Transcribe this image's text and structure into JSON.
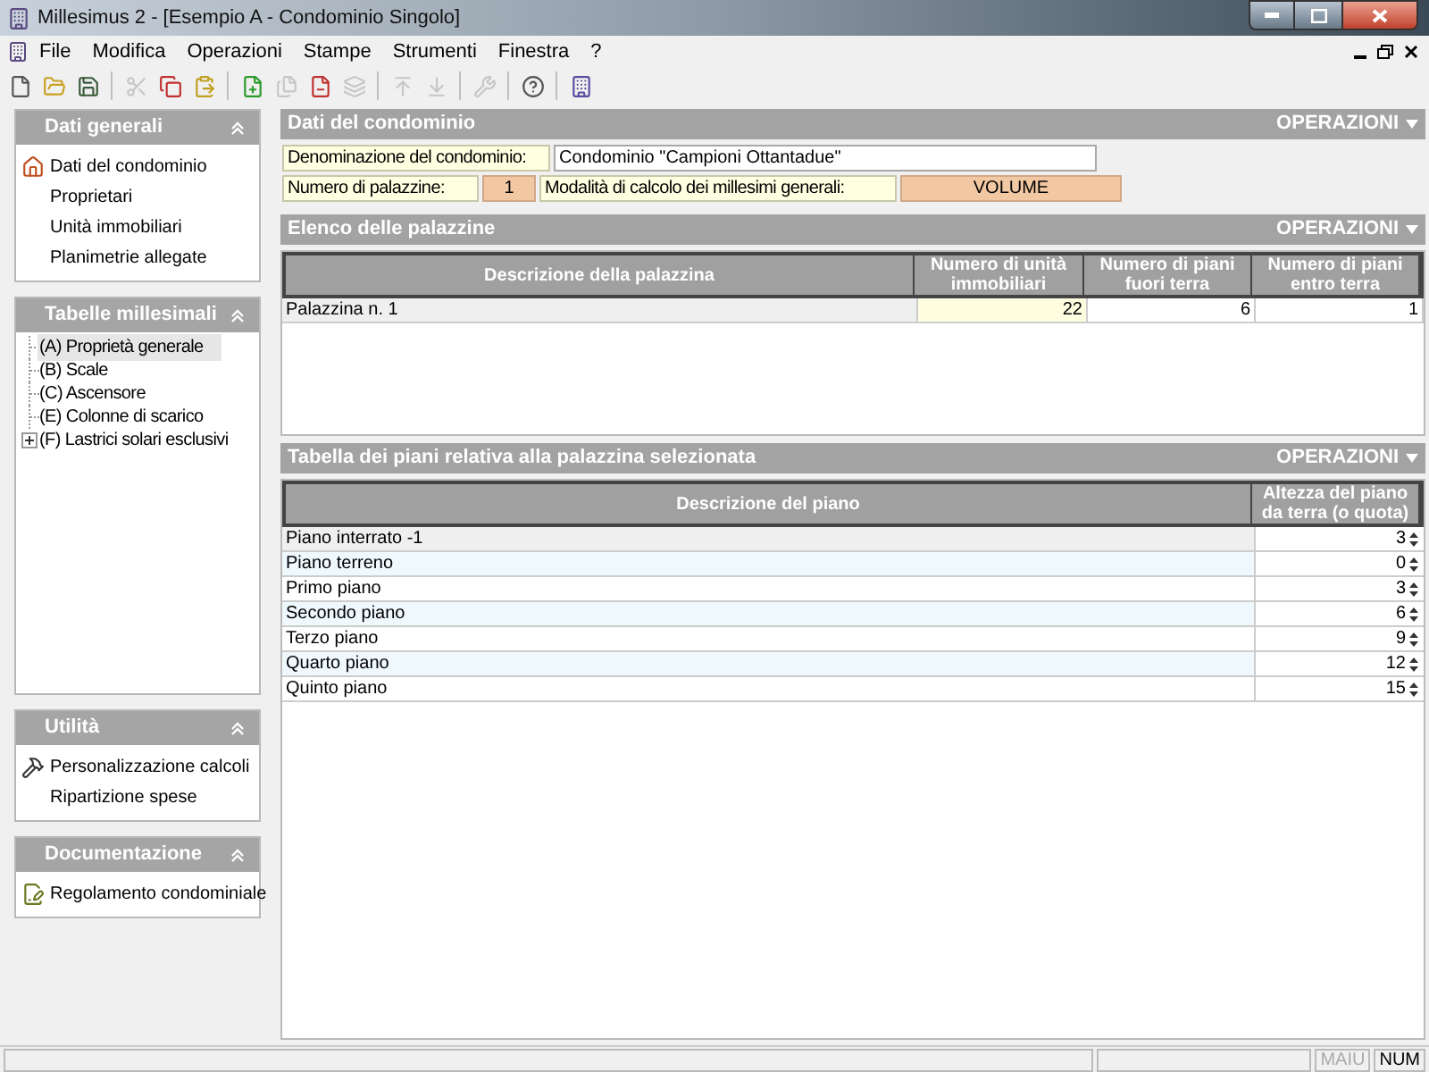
{
  "window": {
    "title": "Millesimus 2 - [Esempio A - Condominio Singolo]"
  },
  "menu": [
    "File",
    "Modifica",
    "Operazioni",
    "Stampe",
    "Strumenti",
    "Finestra",
    "?"
  ],
  "toolbar": [
    {
      "kind": "button",
      "disabled": false
    },
    {
      "kind": "button",
      "disabled": false
    },
    {
      "kind": "button",
      "disabled": false
    },
    {
      "kind": "separator"
    },
    {
      "kind": "button",
      "disabled": true
    },
    {
      "kind": "button",
      "disabled": false
    },
    {
      "kind": "button",
      "disabled": false
    },
    {
      "kind": "separator"
    },
    {
      "kind": "button",
      "disabled": false
    },
    {
      "kind": "button",
      "disabled": true
    },
    {
      "kind": "button",
      "disabled": false
    },
    {
      "kind": "button",
      "disabled": true
    },
    {
      "kind": "separator"
    },
    {
      "kind": "button",
      "disabled": true
    },
    {
      "kind": "button",
      "disabled": true
    },
    {
      "kind": "separator"
    },
    {
      "kind": "button",
      "disabled": true
    },
    {
      "kind": "separator"
    },
    {
      "kind": "button",
      "disabled": false
    },
    {
      "kind": "separator"
    },
    {
      "kind": "button",
      "disabled": false
    }
  ],
  "sidebar": [
    {
      "title": "Dati generali",
      "kind": "links",
      "items": [
        {
          "label": "Dati del condominio",
          "icon": true
        },
        {
          "label": "Proprietari",
          "icon": false
        },
        {
          "label": "Unità immobiliari",
          "icon": false
        },
        {
          "label": "Planimetrie allegate",
          "icon": false
        }
      ]
    },
    {
      "title": "Tabelle millesimali",
      "kind": "tree",
      "items": [
        {
          "label": "(A) Proprietà generale",
          "selected": true,
          "expander": false
        },
        {
          "label": "(B) Scale",
          "selected": false,
          "expander": false
        },
        {
          "label": "(C) Ascensore",
          "selected": false,
          "expander": false
        },
        {
          "label": "(E) Colonne di scarico",
          "selected": false,
          "expander": false
        },
        {
          "label": "(F) Lastrici solari esclusivi",
          "selected": false,
          "expander": true
        }
      ]
    },
    {
      "title": "Utilità",
      "kind": "links",
      "items": [
        {
          "label": "Personalizzazione calcoli",
          "icon": true
        },
        {
          "label": "Ripartizione spese",
          "icon": false
        }
      ]
    },
    {
      "title": "Documentazione",
      "kind": "links",
      "items": [
        {
          "label": "Regolamento condominiale",
          "icon": true
        }
      ]
    }
  ],
  "dati_condominio": {
    "title": "Dati del condominio",
    "operations": "OPERAZIONI",
    "name_label": "Denominazione del condominio:",
    "name_value": "Condominio \"Campioni Ottantadue\"",
    "count_label": "Numero di palazzine:",
    "count_value": "1",
    "mode_label": "Modalità di calcolo dei millesimi generali:",
    "mode_value": "VOLUME"
  },
  "palazzine": {
    "title": "Elenco delle palazzine",
    "operations": "OPERAZIONI",
    "columns": [
      "Descrizione della palazzina",
      "Numero di unità immobiliari",
      "Numero di piani fuori terra",
      "Numero di piani entro terra"
    ],
    "rows": [
      {
        "cells": [
          "Palazzina n. 1",
          "22",
          "6",
          "1"
        ],
        "selected": true
      }
    ]
  },
  "piani": {
    "title": "Tabella dei piani relativa alla palazzina selezionata",
    "operations": "OPERAZIONI",
    "columns": [
      "Descrizione del piano",
      "Altezza del piano da terra (o quota)"
    ],
    "rows": [
      {
        "cells": [
          "Piano interrato -1",
          "3"
        ],
        "selected": true
      },
      {
        "cells": [
          "Piano terreno",
          "0"
        ],
        "selected": false
      },
      {
        "cells": [
          "Primo piano",
          "3"
        ],
        "selected": false
      },
      {
        "cells": [
          "Secondo piano",
          "6"
        ],
        "selected": false
      },
      {
        "cells": [
          "Terzo piano",
          "9"
        ],
        "selected": false
      },
      {
        "cells": [
          "Quarto piano",
          "12"
        ],
        "selected": false
      },
      {
        "cells": [
          "Quinto piano",
          "15"
        ],
        "selected": false
      }
    ]
  },
  "status_bar": [
    {
      "text": "MAIU",
      "on": false
    },
    {
      "text": "NUM",
      "on": true
    }
  ]
}
